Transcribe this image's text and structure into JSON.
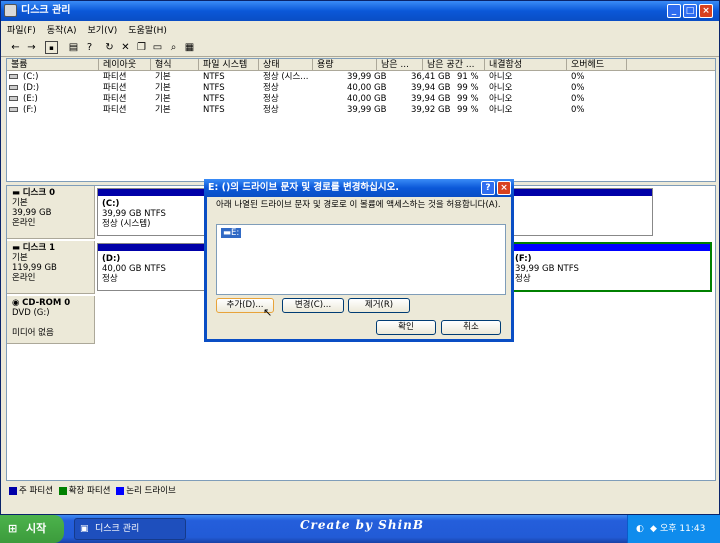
{
  "window": {
    "title": "디스크 관리",
    "min": "_",
    "max": "□",
    "close": "×"
  },
  "menu": [
    "파일(F)",
    "동작(A)",
    "보기(V)",
    "도움말(H)"
  ],
  "columns": [
    "볼륨",
    "레이아웃",
    "형식",
    "파일 시스템",
    "상태",
    "용량",
    "남은 ...",
    "남은 공간 ...",
    "내결함성",
    "오버헤드"
  ],
  "volumes": [
    [
      "(C:)",
      "파티션",
      "기본",
      "NTFS",
      "정상 (시스...",
      "39,99 GB",
      "36,41 GB",
      "91 %",
      "아니오",
      "0%"
    ],
    [
      "(D:)",
      "파티션",
      "기본",
      "NTFS",
      "정상",
      "40,00 GB",
      "39,94 GB",
      "99 %",
      "아니오",
      "0%"
    ],
    [
      "(E:)",
      "파티션",
      "기본",
      "NTFS",
      "정상",
      "40,00 GB",
      "39,94 GB",
      "99 %",
      "아니오",
      "0%"
    ],
    [
      "(F:)",
      "파티션",
      "기본",
      "NTFS",
      "정상",
      "39,99 GB",
      "39,92 GB",
      "99 %",
      "아니오",
      "0%"
    ]
  ],
  "disks": [
    {
      "name": "디스크 0",
      "type": "기본",
      "size": "39,99 GB",
      "status": "온라인"
    },
    {
      "name": "디스크 1",
      "type": "기본",
      "size": "119,99 GB",
      "status": "온라인"
    },
    {
      "name": "CD-ROM 0",
      "type": "DVD (G:)",
      "size": "",
      "status": "미디어 없음"
    }
  ],
  "partitions": {
    "c": {
      "name": "(C:)",
      "size": "39,99 GB NTFS",
      "status": "정상 (시스템)"
    },
    "d": {
      "name": "(D:)",
      "size": "40,00 GB NTFS",
      "status": "정상"
    },
    "f": {
      "name": "(F:)",
      "size": "39,99 GB NTFS",
      "status": "정상"
    }
  },
  "legend": [
    "주 파티션",
    "확장 파티션",
    "논리 드라이브"
  ],
  "legend_colors": [
    "#0000a8",
    "#008000",
    "#0000ff"
  ],
  "dialog": {
    "title": "E: ()의 드라이브 문자 및 경로를 변경하십시오.",
    "help": "?",
    "close": "×",
    "description": "아래 나열된 드라이브 문자 및 경로로 이 볼륨에 액세스하는 것을 허용합니다(A).",
    "list_item": "E:",
    "add": "추가(D)...",
    "change": "변경(C)...",
    "remove": "제거(R)",
    "ok": "확인",
    "cancel": "취소"
  },
  "taskbar": {
    "start": "시작",
    "task": "디스크 관리",
    "brand": "Create by ShinB",
    "clock": "오후 11:43"
  }
}
